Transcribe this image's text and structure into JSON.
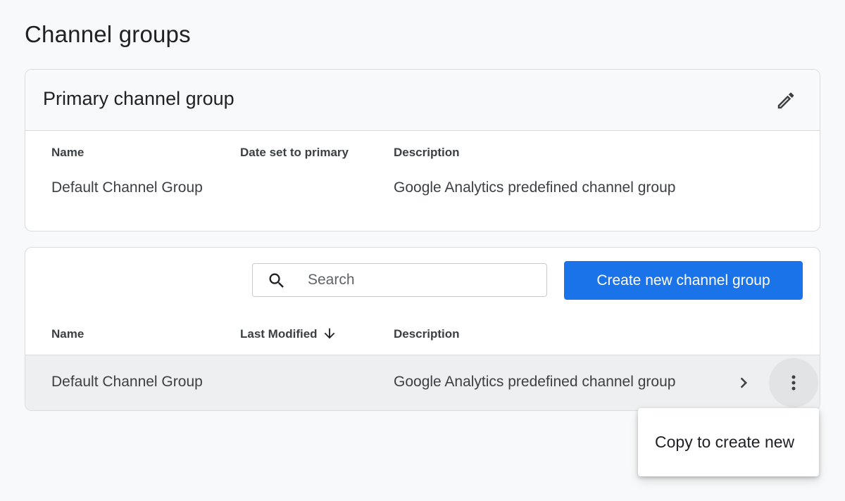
{
  "page": {
    "title": "Channel groups"
  },
  "primary": {
    "title": "Primary channel group",
    "edit_icon": "pencil-icon",
    "columns": {
      "name": "Name",
      "date": "Date set to primary",
      "description": "Description"
    },
    "row": {
      "name": "Default Channel Group",
      "date": "",
      "description": "Google Analytics predefined channel group"
    }
  },
  "list": {
    "search": {
      "placeholder": "Search",
      "value": "",
      "icon": "search-icon"
    },
    "create_label": "Create new channel group",
    "columns": {
      "name": "Name",
      "modified": "Last Modified",
      "description": "Description",
      "sort_icon": "arrow-down-icon"
    },
    "rows": [
      {
        "name": "Default Channel Group",
        "modified": "",
        "description": "Google Analytics predefined channel group",
        "open_icon": "chevron-right-icon",
        "menu_icon": "more-vert-icon"
      }
    ]
  },
  "menu": {
    "items": [
      {
        "label": "Copy to create new"
      }
    ]
  },
  "colors": {
    "accent": "#1a73e8",
    "background": "#f8f9fa",
    "border": "#dadce0",
    "row_hover": "#eeeff0"
  }
}
